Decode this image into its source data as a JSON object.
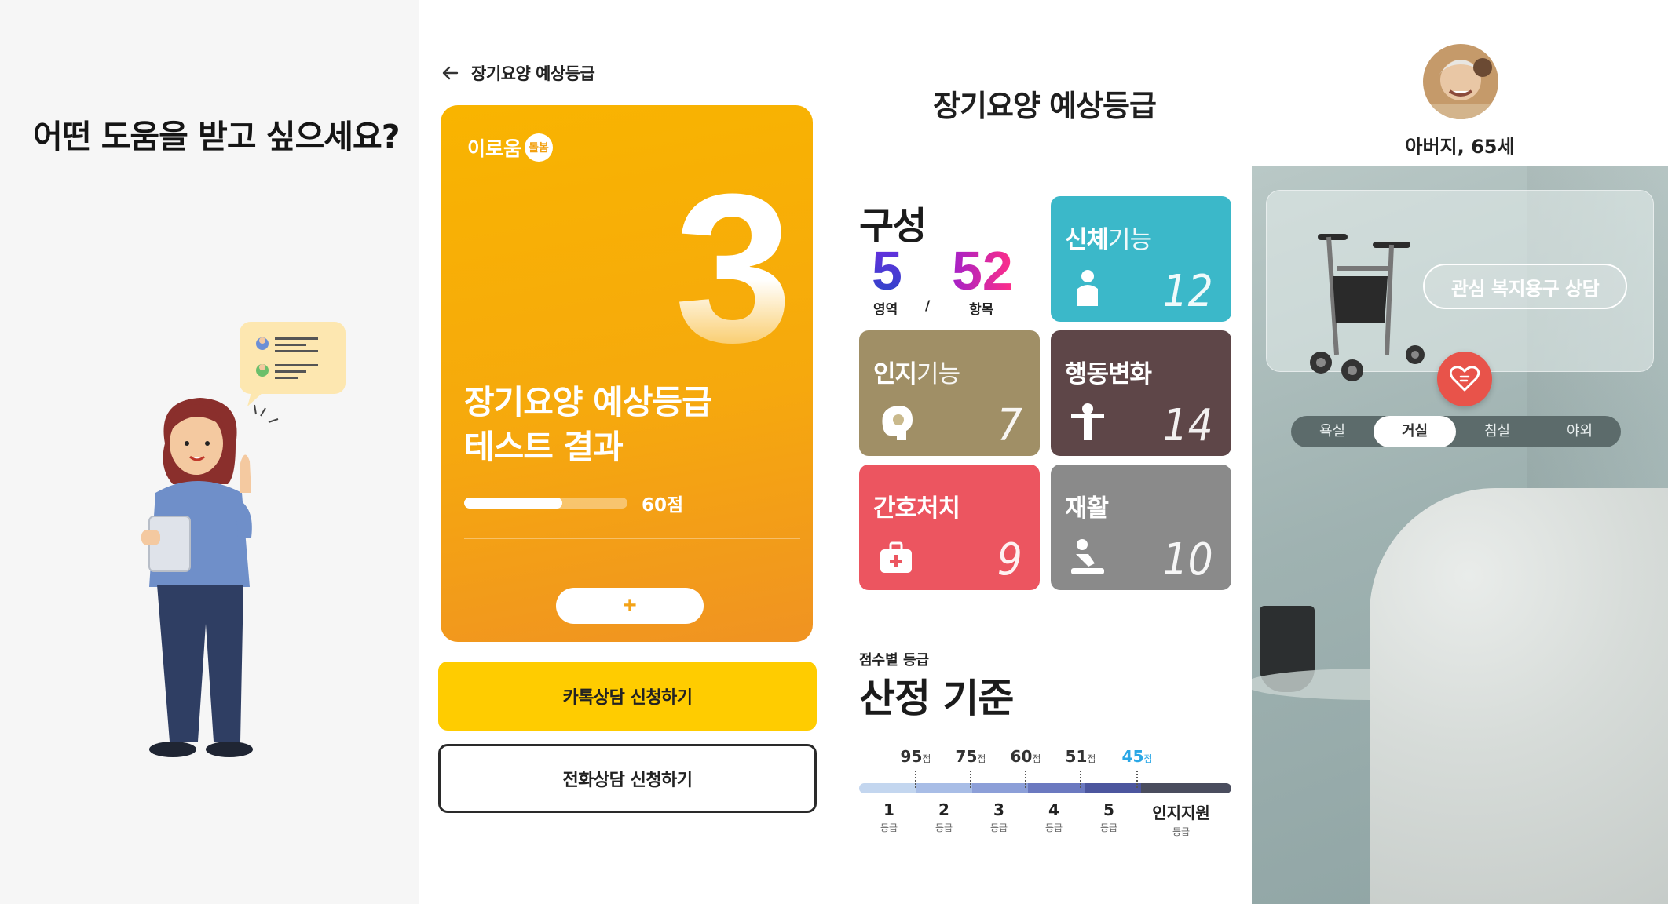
{
  "panel1": {
    "question": "어떤 도움을 받고 싶으세요?"
  },
  "panel2": {
    "header_title": "장기요양 예상등급",
    "card": {
      "brand": "이로움",
      "brand_mark": "돌봄",
      "grade": "3",
      "title_line1": "장기요양 예상등급",
      "title_line2": "테스트 결과",
      "score_label": "60점",
      "score_progress": 0.6,
      "plus_label": "+"
    },
    "kakao_button": "카톡상담 신청하기",
    "phone_button": "전화상담 신청하기",
    "colors": {
      "card": "#f6a90d",
      "kakao": "#ffcc00"
    }
  },
  "panel3": {
    "title": "장기요양 예상등급",
    "composition_label": "구성",
    "areas_count": "5",
    "areas_caption": "영역",
    "slash": "/",
    "items_count": "52",
    "items_caption": "항목",
    "tiles": [
      {
        "bold": "신체",
        "light": "기능",
        "count": "12",
        "color": "#3bb8c9",
        "icon": "person-icon"
      },
      {
        "bold": "인지",
        "light": "기능",
        "count": "7",
        "color": "#a08f66",
        "icon": "brain-icon"
      },
      {
        "bold": "행동변화",
        "light": "",
        "count": "14",
        "color": "#5e4648",
        "icon": "gesture-person-icon"
      },
      {
        "bold": "간호처치",
        "light": "",
        "count": "9",
        "color": "#ec5560",
        "icon": "first-aid-kit-icon"
      },
      {
        "bold": "재활",
        "light": "",
        "count": "10",
        "color": "#8a8a8a",
        "icon": "rehab-icon"
      }
    ],
    "criteria_sub": "점수별 등급",
    "criteria_title": "산정 기준",
    "score_unit": "점",
    "thresholds": [
      "95",
      "75",
      "60",
      "51",
      "45"
    ],
    "grade_unit": "등급",
    "grades": [
      "1",
      "2",
      "3",
      "4",
      "5",
      "인지지원"
    ]
  },
  "panel4": {
    "person": "아버지, 65세",
    "consult_button": "관심 복지용구 상담",
    "tabs": [
      "욕실",
      "거실",
      "침실",
      "야외"
    ],
    "active_tab": "거실",
    "colors": {
      "heart": "#e8534a"
    }
  }
}
